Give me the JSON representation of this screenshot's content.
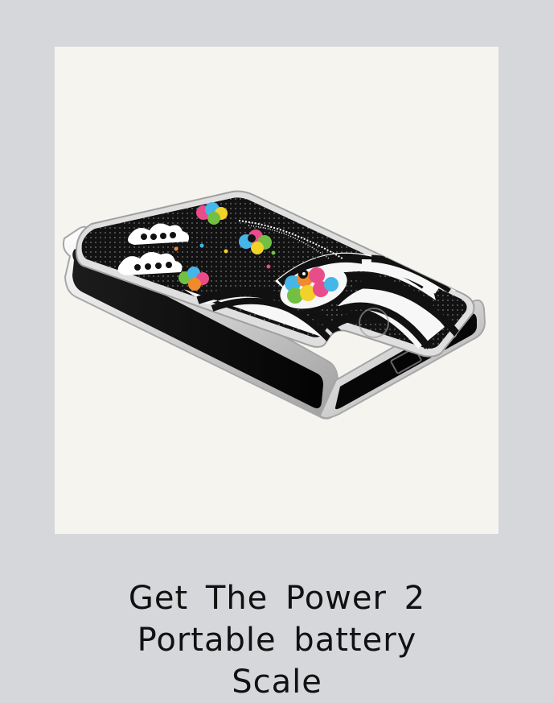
{
  "product": {
    "image_alt": "Patterned portable battery",
    "title_lines": [
      "Get The Power 2",
      "Portable battery",
      "Scale"
    ]
  },
  "colors": {
    "page_background": "#d6d7db",
    "image_background": "#f5f4ef",
    "battery_shell": "#d8d8d8",
    "battery_body": "#111111",
    "accent_pink": "#e84d8a",
    "accent_blue": "#45b6e8",
    "accent_yellow": "#f2d12b",
    "accent_green": "#72c043",
    "accent_orange": "#f08a2b"
  }
}
